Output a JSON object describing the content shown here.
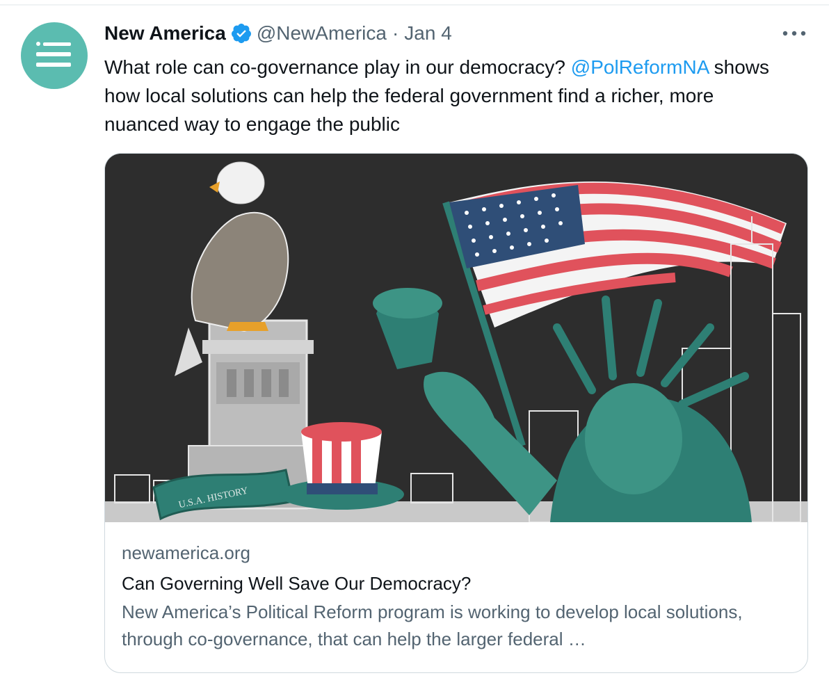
{
  "tweet": {
    "display_name": "New America",
    "handle": "@NewAmerica",
    "separator": "·",
    "date": "Jan 4",
    "text_part1": "What role can co-governance play in our democracy?",
    "mention": "@PolReformNA",
    "text_part2": "shows how local solutions can help the federal government find a richer, more nuanced way to engage the public",
    "avatar_icon": "list-icon",
    "verified_icon": "verified-badge-icon",
    "more_icon": "more-options-icon"
  },
  "card": {
    "image_alt": "Illustration of an eagle, Statue of Liberty, American flag, Uncle Sam hat and city skyline",
    "banner_text": "U.S.A. HISTORY",
    "domain": "newamerica.org",
    "title": "Can Governing Well Save Our Democracy?",
    "description": "New America’s Political Reform program is working to develop local solutions, through co-governance, that can help the larger federal …"
  },
  "colors": {
    "avatar_bg": "#5bbcb0",
    "verified": "#1d9bf0",
    "link": "#1d9bf0",
    "secondary_text": "#536471",
    "teal": "#2e7f74",
    "flag_red": "#e0525c",
    "flag_blue": "#2f4e77"
  }
}
